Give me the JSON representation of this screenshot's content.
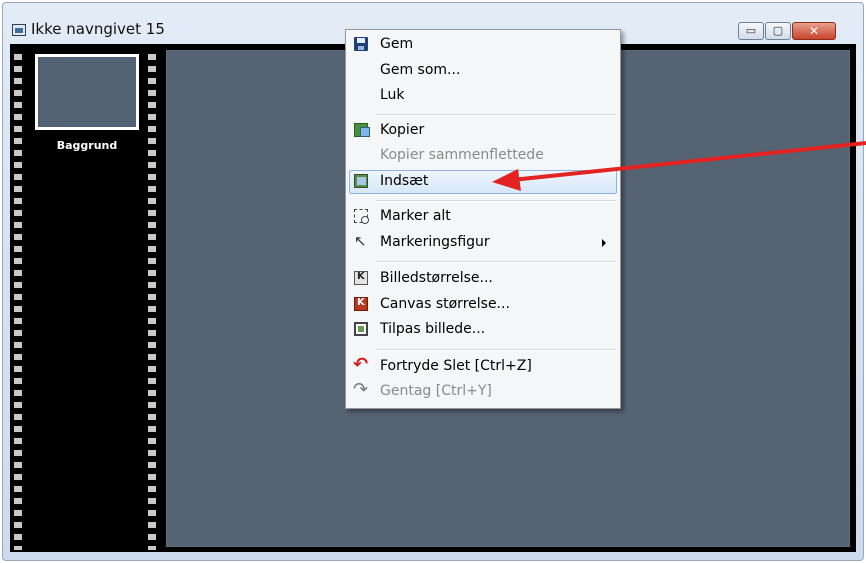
{
  "window": {
    "title": "Ikke navngivet 15",
    "buttons": {
      "minimize": "▭",
      "maximize": "▢",
      "close": "✕"
    }
  },
  "layers": {
    "thumbnail_label": "Baggrund"
  },
  "context_menu": {
    "items": {
      "gem": "Gem",
      "gem_som": "Gem som...",
      "luk": "Luk",
      "kopier": "Kopier",
      "kopier_sammenflettede": "Kopier sammenflettede",
      "indsaet": "Indsæt",
      "marker_alt": "Marker alt",
      "markeringsfigur": "Markeringsfigur",
      "billedstorrelse": "Billedstørrelse...",
      "canvas_storrelse": "Canvas størrelse...",
      "tilpas_billede": "Tilpas billede...",
      "fortryde": "Fortryde Slet [Ctrl+Z]",
      "gentag": "Gentag [Ctrl+Y]"
    },
    "disabled": [
      "Kopier sammenflettede",
      "Gentag [Ctrl+Y]"
    ],
    "highlighted": "Indsæt"
  },
  "colors": {
    "canvas": "#556372",
    "menu_highlight_border": "#8fb4e3",
    "annotation_arrow": "#e32222",
    "undo_icon": "#d12020"
  },
  "icons": {
    "gem": "floppy-disk-icon",
    "kopier": "copy-icon",
    "indsaet": "paste-icon",
    "marker_alt": "select-all-icon",
    "markeringsfigur": "cursor-icon",
    "billedstorrelse": "image-size-icon",
    "canvas_storrelse": "canvas-size-icon",
    "tilpas_billede": "fit-image-icon",
    "fortryde": "undo-icon",
    "gentag": "redo-icon"
  }
}
